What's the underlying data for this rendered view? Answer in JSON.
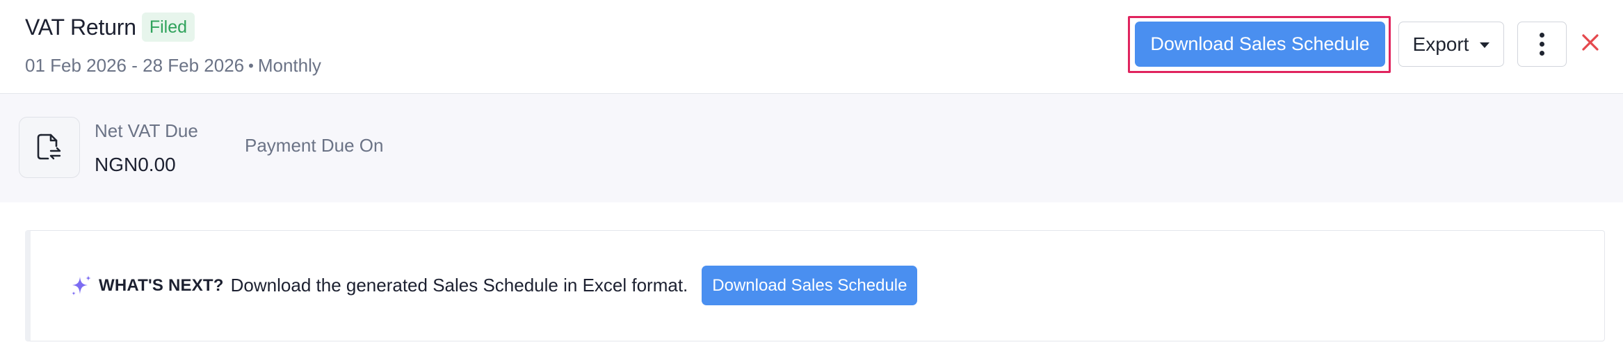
{
  "header": {
    "title": "VAT Return",
    "status_badge": "Filed",
    "period": "01 Feb 2026 - 28 Feb 2026",
    "separator": "•",
    "frequency": "Monthly",
    "primary_action_label": "Download Sales Schedule",
    "export_label": "Export",
    "more_icon": "vertical-dots-icon",
    "close_icon": "close-icon"
  },
  "summary": {
    "icon": "document-exchange-icon",
    "net_vat_label": "Net VAT Due",
    "net_vat_value": "NGN0.00",
    "payment_due_label": "Payment Due On"
  },
  "whats_next": {
    "icon": "sparkle-icon",
    "heading": "WHAT'S NEXT?",
    "text": "Download the generated Sales Schedule in Excel format.",
    "button_label": "Download Sales Schedule"
  },
  "colors": {
    "primary": "#4a8ff0",
    "badge_bg": "#e7f5ec",
    "badge_text": "#2fa25b",
    "highlight_border": "#e0245e",
    "close": "#e5484d",
    "sparkle": "#7c6cf2"
  }
}
